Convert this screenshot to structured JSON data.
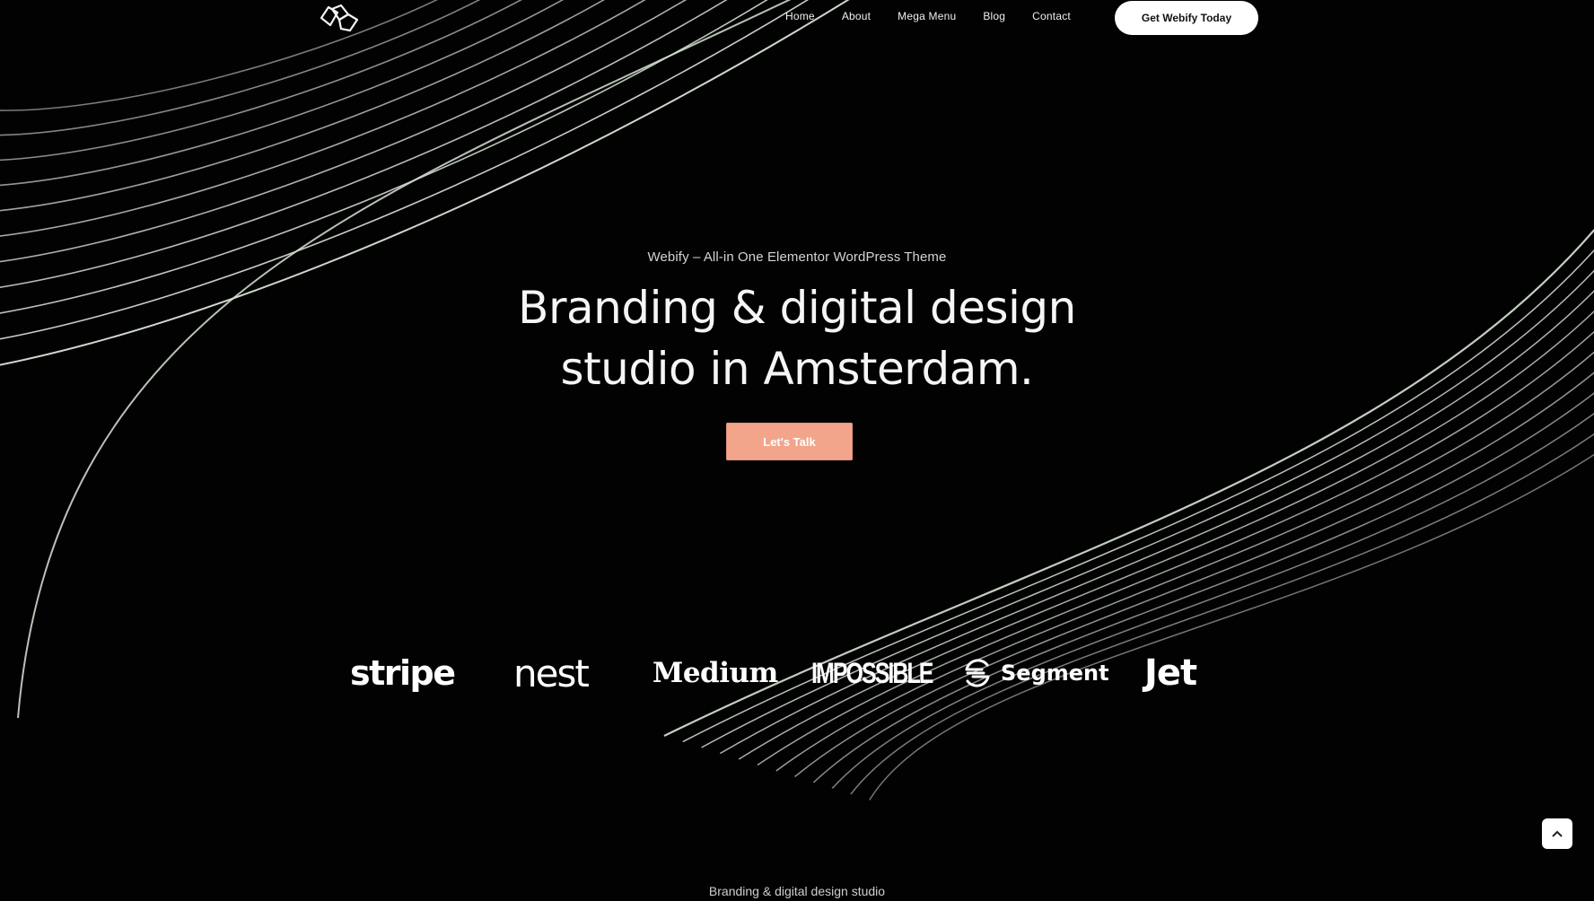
{
  "header": {
    "logo_icon": "webify-hexagon-logo",
    "nav": [
      {
        "label": "Home"
      },
      {
        "label": "About"
      },
      {
        "label": "Mega Menu"
      },
      {
        "label": "Blog"
      },
      {
        "label": "Contact"
      }
    ],
    "cta_label": "Get Webify Today"
  },
  "hero": {
    "eyebrow": "Webify – All-in One Elementor WordPress Theme",
    "headline_line1": "Branding & digital design",
    "headline_line2": "studio in Amsterdam.",
    "cta_label": "Let's Talk"
  },
  "brands": {
    "stripe": "stripe",
    "nest": "nest",
    "medium": "Medium",
    "impossible": "IMPOSSIBLE",
    "segment": "Segment",
    "jet": "Jet"
  },
  "scroll_top_icon": "chevron-up-icon",
  "footer_caption": "Branding & digital design studio",
  "colors": {
    "background": "#020202",
    "accent": "#f2a58b",
    "line": "#d8e4d6"
  }
}
